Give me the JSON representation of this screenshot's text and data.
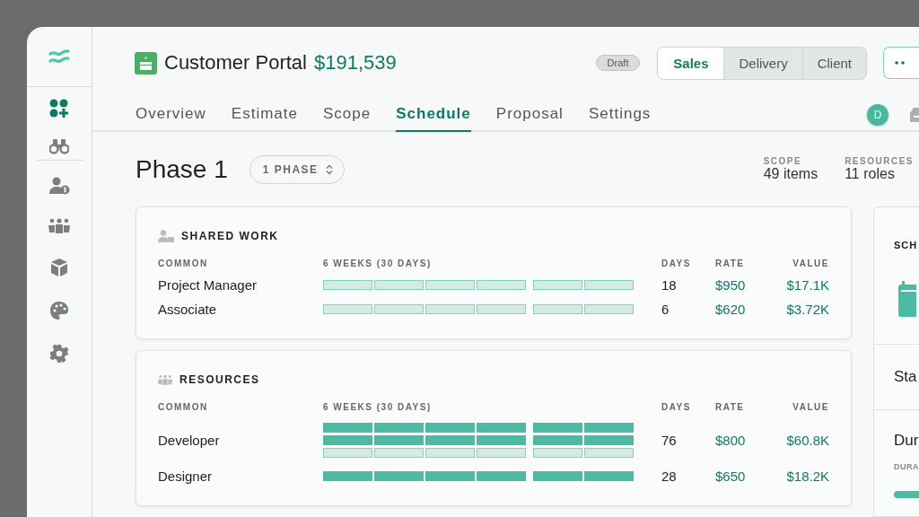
{
  "sidebar": {
    "groups": [
      [
        {
          "selected": true
        },
        {
          "selected": false
        }
      ],
      [
        {
          "selected": false
        },
        {
          "selected": false
        },
        {
          "selected": false
        },
        {
          "selected": false
        },
        {
          "selected": false
        }
      ]
    ]
  },
  "header": {
    "title": "Customer Portal",
    "amount": "$191,539",
    "status": "Draft",
    "views": [
      {
        "label": "Sales",
        "selected": true
      },
      {
        "label": "Delivery",
        "selected": false
      },
      {
        "label": "Client",
        "selected": false
      }
    ]
  },
  "tabs": [
    {
      "label": "Overview",
      "selected": false
    },
    {
      "label": "Estimate",
      "selected": false
    },
    {
      "label": "Scope",
      "selected": false
    },
    {
      "label": "Schedule",
      "selected": true
    },
    {
      "label": "Proposal",
      "selected": false
    },
    {
      "label": "Settings",
      "selected": false
    }
  ],
  "avatar": "D",
  "phase": {
    "title": "Phase 1",
    "picker": "1 PHASE",
    "stats": [
      {
        "label": "SCOPE",
        "value": "49 items"
      },
      {
        "label": "RESOURCES",
        "value": "11 roles"
      }
    ]
  },
  "sections": [
    {
      "title": "SHARED WORK",
      "columns": [
        "COMMON",
        "6 WEEKS (30 DAYS)",
        "DAYS",
        "RATE",
        "VALUE"
      ],
      "rows": [
        {
          "name": "Project Manager",
          "tracks": [
            [
              false,
              false,
              false,
              false,
              false,
              false
            ]
          ],
          "days": "18",
          "rate": "$950",
          "value": "$17.1K"
        },
        {
          "name": "Associate",
          "tracks": [
            [
              false,
              false,
              false,
              false,
              false,
              false
            ]
          ],
          "days": "6",
          "rate": "$620",
          "value": "$3.72K"
        }
      ]
    },
    {
      "title": "RESOURCES",
      "columns": [
        "COMMON",
        "6 WEEKS (30 DAYS)",
        "DAYS",
        "RATE",
        "VALUE"
      ],
      "rows": [
        {
          "name": "Developer",
          "tracks": [
            [
              true,
              true,
              true,
              true,
              true,
              true
            ],
            [
              true,
              true,
              true,
              true,
              true,
              true
            ],
            [
              false,
              false,
              false,
              false,
              false,
              false
            ]
          ],
          "days": "76",
          "rate": "$800",
          "value": "$60.8K"
        },
        {
          "name": "Designer",
          "tracks": [
            [
              true,
              true,
              true,
              true,
              true,
              true
            ]
          ],
          "days": "28",
          "rate": "$650",
          "value": "$18.2K"
        }
      ]
    }
  ],
  "panel": {
    "title": "SCH",
    "start": "Sta",
    "duration": "Dur",
    "duration_caption": "DURA"
  }
}
